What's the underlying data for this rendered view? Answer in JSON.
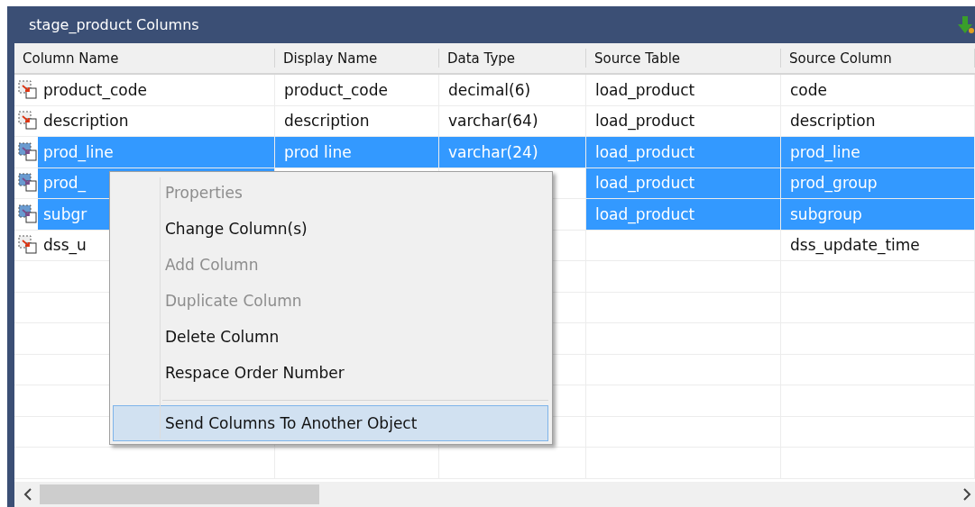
{
  "window": {
    "title": "stage_product Columns"
  },
  "table": {
    "columns": [
      "Column Name",
      "Display Name",
      "Data Type",
      "Source Table",
      "Source Column"
    ],
    "rows": [
      {
        "cells": [
          "product_code",
          "product_code",
          "decimal(6)",
          "load_product",
          "code"
        ],
        "selected": false
      },
      {
        "cells": [
          "description",
          "description",
          "varchar(64)",
          "load_product",
          "description"
        ],
        "selected": false
      },
      {
        "cells": [
          "prod_line",
          "prod line",
          "varchar(24)",
          "load_product",
          "prod_line"
        ],
        "selected": true
      },
      {
        "cells": [
          "prod_",
          null,
          null,
          "load_product",
          "prod_group"
        ],
        "selected": true
      },
      {
        "cells": [
          "subgr",
          null,
          null,
          "load_product",
          "subgroup"
        ],
        "selected": true
      },
      {
        "cells": [
          "dss_u",
          null,
          null,
          null,
          "dss_update_time"
        ],
        "selected": false
      }
    ]
  },
  "context_menu": {
    "items": [
      {
        "label": "Properties",
        "disabled": true,
        "selected": false
      },
      {
        "label": "Change Column(s)",
        "disabled": false,
        "selected": false
      },
      {
        "label": "Add Column",
        "disabled": true,
        "selected": false
      },
      {
        "label": "Duplicate Column",
        "disabled": true,
        "selected": false
      },
      {
        "label": "Delete Column",
        "disabled": false,
        "selected": false
      },
      {
        "label": "Respace Order Number",
        "disabled": false,
        "selected": false
      },
      {
        "kind": "separator"
      },
      {
        "label": "Send Columns To Another Object",
        "disabled": false,
        "selected": true
      }
    ]
  }
}
